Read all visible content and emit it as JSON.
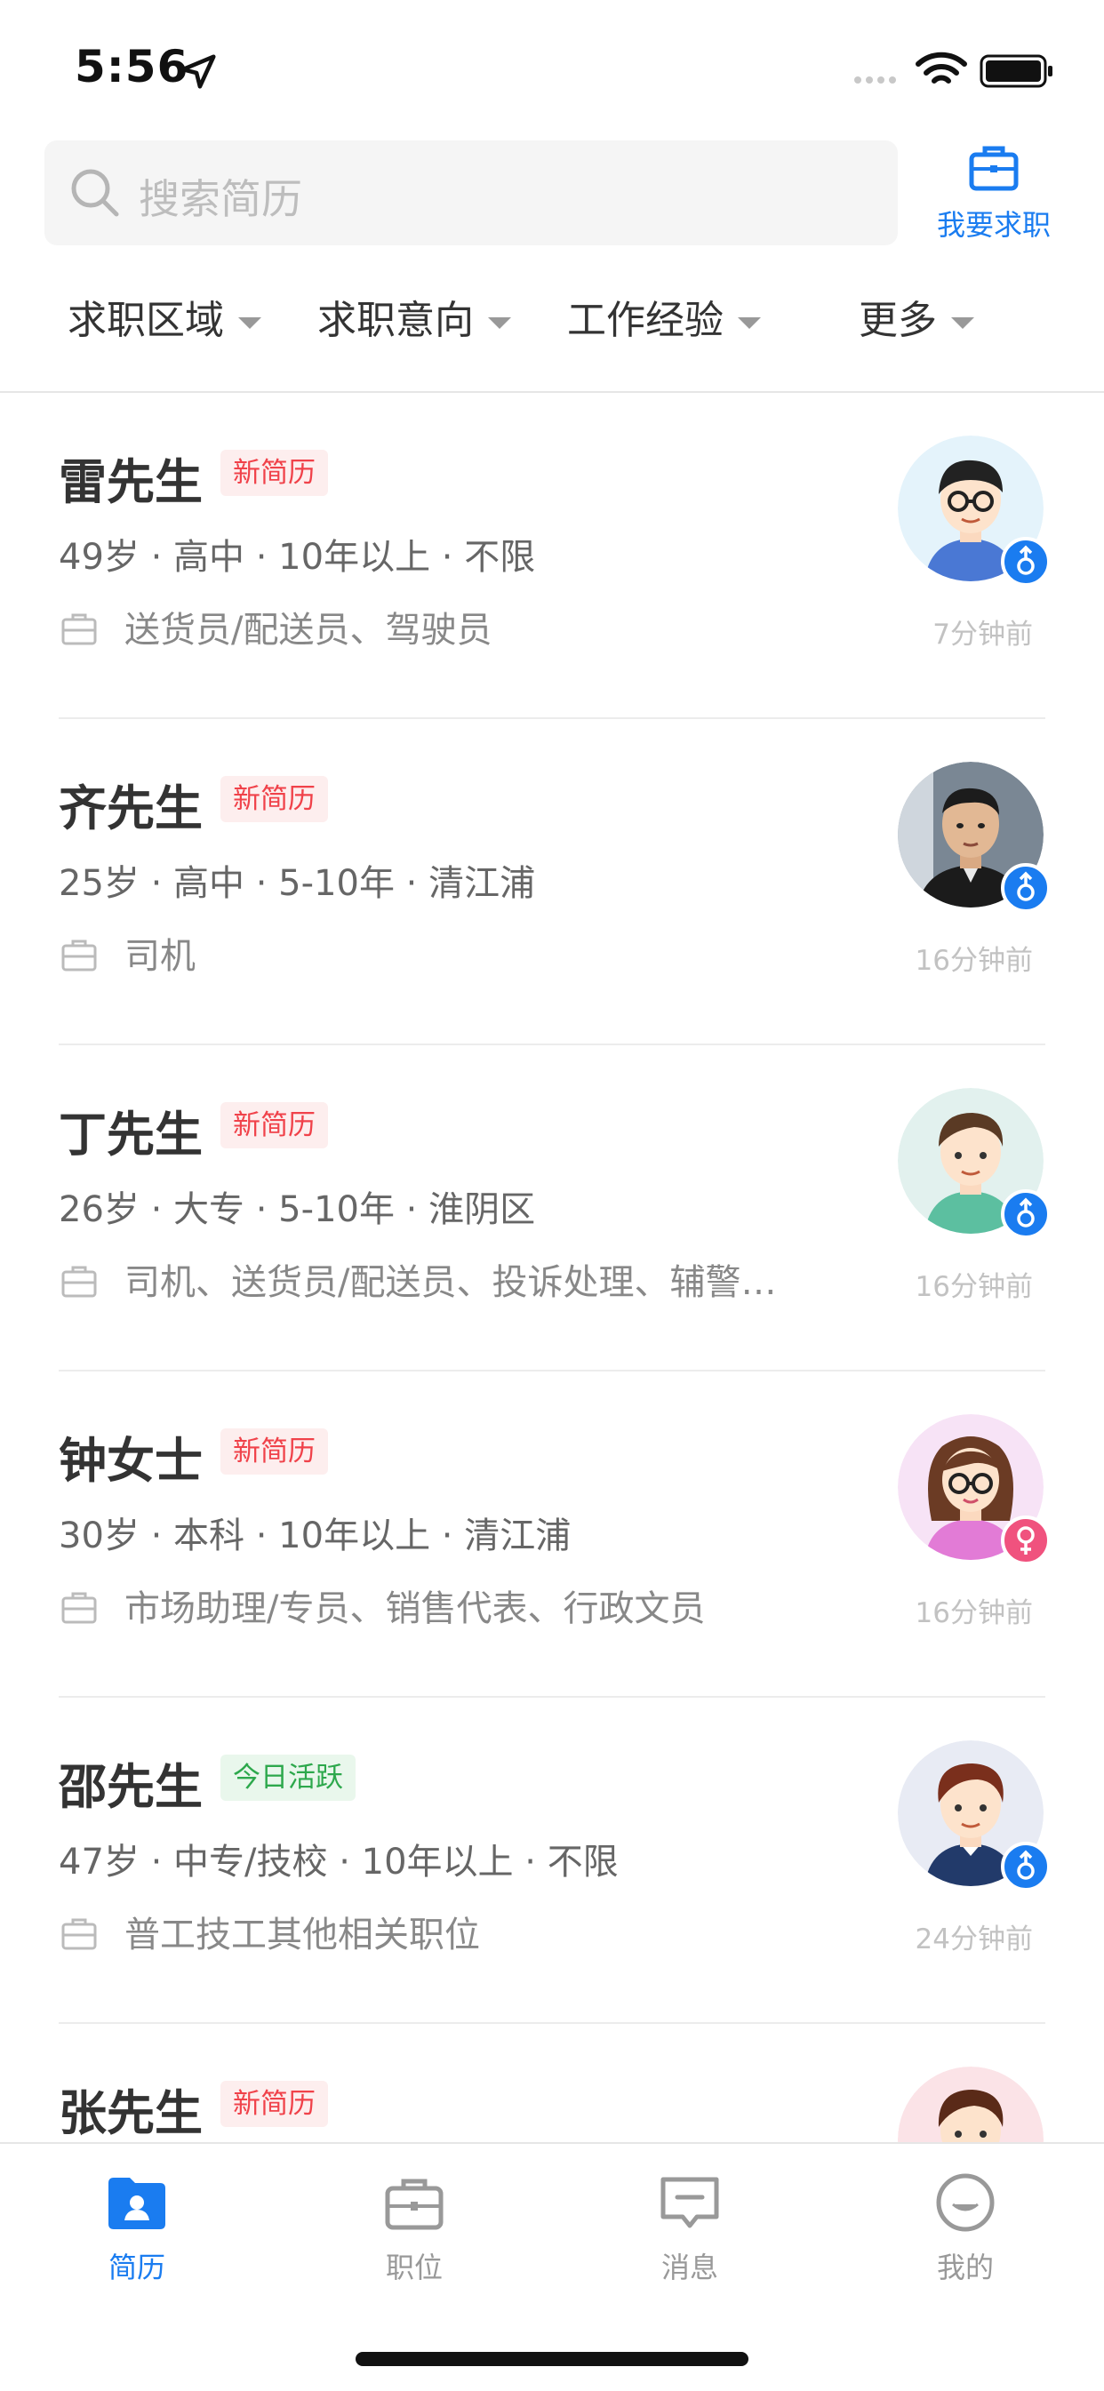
{
  "status_bar": {
    "time": "5:56"
  },
  "search": {
    "placeholder": "搜索简历"
  },
  "job_seek_button": {
    "label": "我要求职"
  },
  "filters": [
    {
      "label": "求职区域"
    },
    {
      "label": "求职意向"
    },
    {
      "label": "工作经验"
    },
    {
      "label": "更多"
    }
  ],
  "resumes": [
    {
      "name": "雷先生",
      "tag": "新简历",
      "tag_type": "new",
      "meta": "49岁 · 高中 · 10年以上 · 不限",
      "jobs": "送货员/配送员、驾驶员",
      "time_ago": "7分钟前",
      "gender": "male",
      "avatar": "cartoon-man-glasses-avatar"
    },
    {
      "name": "齐先生",
      "tag": "新简历",
      "tag_type": "new",
      "meta": "25岁 · 高中 · 5-10年 · 清江浦",
      "jobs": "司机",
      "time_ago": "16分钟前",
      "gender": "male",
      "avatar": "photo-man-avatar"
    },
    {
      "name": "丁先生",
      "tag": "新简历",
      "tag_type": "new",
      "meta": "26岁 · 大专 · 5-10年 · 淮阴区",
      "jobs": "司机、送货员/配送员、投诉处理、辅警…",
      "time_ago": "16分钟前",
      "gender": "male",
      "avatar": "cartoon-man-avatar"
    },
    {
      "name": "钟女士",
      "tag": "新简历",
      "tag_type": "new",
      "meta": "30岁 · 本科 · 10年以上 · 清江浦",
      "jobs": "市场助理/专员、销售代表、行政文员",
      "time_ago": "16分钟前",
      "gender": "female",
      "avatar": "cartoon-woman-glasses-avatar"
    },
    {
      "name": "邵先生",
      "tag": "今日活跃",
      "tag_type": "active",
      "meta": "47岁 · 中专/技校 · 10年以上 · 不限",
      "jobs": "普工技工其他相关职位",
      "time_ago": "24分钟前",
      "gender": "male",
      "avatar": "cartoon-man-avatar"
    },
    {
      "name": "张先生",
      "tag": "新简历",
      "tag_type": "new",
      "meta": "",
      "jobs": "",
      "time_ago": "",
      "gender": "male",
      "avatar": "cartoon-man-avatar"
    }
  ],
  "tabbar": [
    {
      "label": "简历",
      "icon": "resume-icon",
      "active": true
    },
    {
      "label": "职位",
      "icon": "briefcase-icon",
      "active": false
    },
    {
      "label": "消息",
      "icon": "message-icon",
      "active": false
    },
    {
      "label": "我的",
      "icon": "profile-icon",
      "active": false
    }
  ],
  "colors": {
    "accent": "#1a7cf0",
    "new_tag": "#f0424a",
    "active_tag": "#2da84c",
    "female": "#f0527e"
  }
}
